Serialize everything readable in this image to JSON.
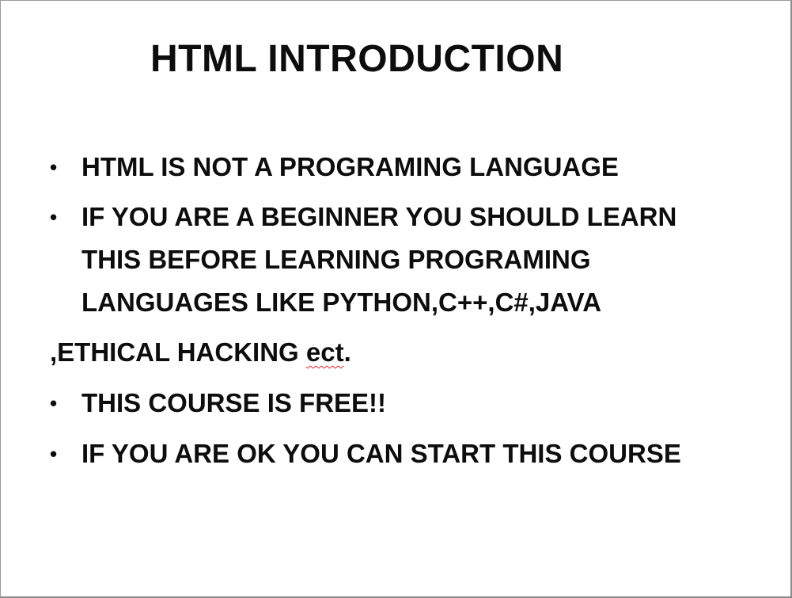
{
  "slide": {
    "title": "HTML INTRODUCTION",
    "bullet_glyph": "•",
    "lines": [
      "HTML IS NOT A PROGRAMING LANGUAGE",
      "IF YOU ARE A BEGINNER YOU SHOULD LEARN",
      "THIS BEFORE LEARNING PROGRAMING",
      "LANGUAGES LIKE PYTHON,C++,C#,JAVA",
      ",ETHICAL HACKING ",
      "ect",
      ".",
      "THIS COURSE IS FREE!!",
      "IF YOU ARE OK YOU CAN START THIS COURSE"
    ],
    "spellcheck_color": "#e02020"
  }
}
